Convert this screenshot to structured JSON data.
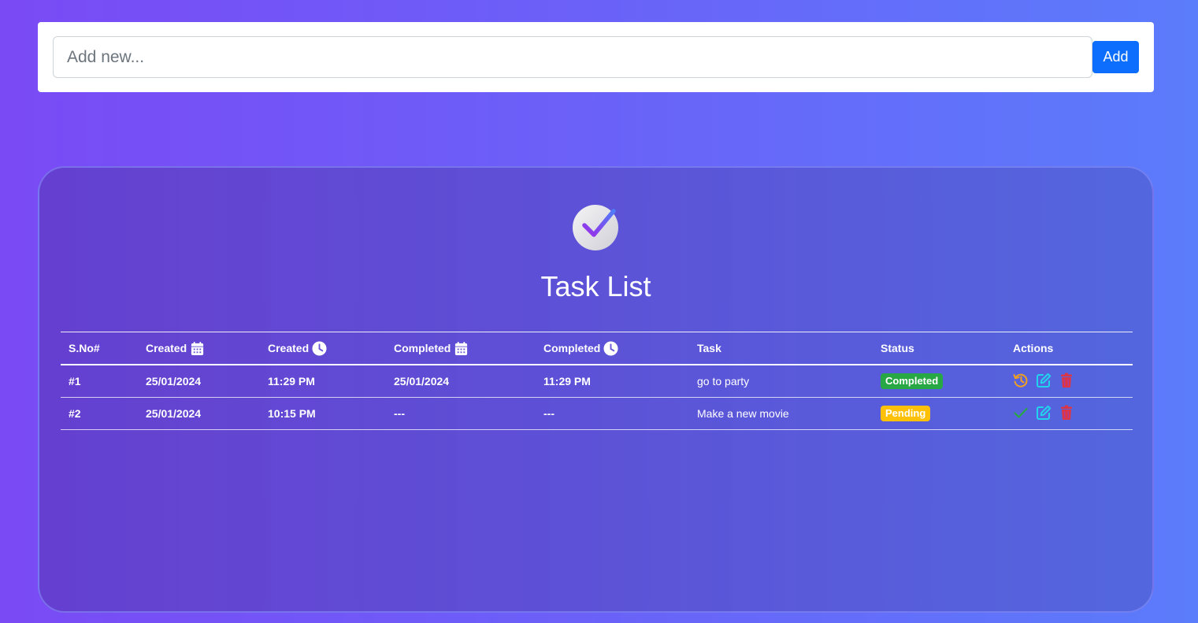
{
  "add_bar": {
    "input_placeholder": "Add new...",
    "input_value": "",
    "button_label": "Add"
  },
  "panel": {
    "logo_icon": "check-circle-icon",
    "title": "Task List"
  },
  "table": {
    "headers": {
      "sno": "S.No#",
      "created_date": "Created",
      "created_time": "Created",
      "completed_date": "Completed",
      "completed_time": "Completed",
      "task": "Task",
      "status": "Status",
      "actions": "Actions"
    },
    "header_icons": {
      "created_date": "calendar-icon",
      "created_time": "clock-icon",
      "completed_date": "calendar-icon",
      "completed_time": "clock-icon"
    },
    "rows": [
      {
        "sno": "#1",
        "created_date": "25/01/2024",
        "created_time": "11:29 PM",
        "completed_date": "25/01/2024",
        "completed_time": "11:29 PM",
        "task": "go to party",
        "status": "Completed",
        "actions": [
          "history-icon",
          "edit-icon",
          "trash-icon"
        ]
      },
      {
        "sno": "#2",
        "created_date": "25/01/2024",
        "created_time": "10:15 PM",
        "completed_date": "---",
        "completed_time": "---",
        "task": "Make a new movie",
        "status": "Pending",
        "actions": [
          "check-icon",
          "edit-icon",
          "trash-icon"
        ]
      }
    ]
  },
  "colors": {
    "accent": "#0d6efd",
    "completed": "#28a745",
    "pending": "#ffc107",
    "history": "#f0a020",
    "edit": "#22d3ee",
    "delete": "#dc3545",
    "check": "#28a745"
  }
}
